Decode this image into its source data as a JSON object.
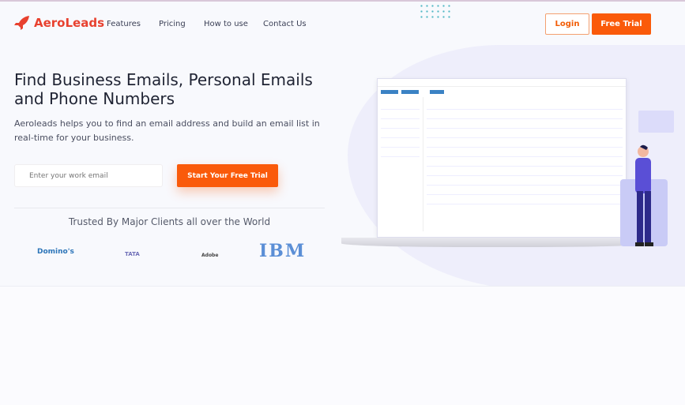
{
  "brand": {
    "name": "AeroLeads",
    "color": "#e8412f",
    "icon": "rocket-icon"
  },
  "nav": {
    "links": [
      "Features",
      "Pricing",
      "How to use",
      "Contact Us"
    ],
    "login": "Login",
    "free_trial": "Free Trial"
  },
  "hero": {
    "title": "Find Business Emails, Personal Emails and Phone Numbers",
    "subtitle": "Aeroleads helps you to find an email address and build an email list in real-time for your business.",
    "email_placeholder": "Enter your work email",
    "cta": "Start Your Free Trial",
    "accent": "#fa5a0a"
  },
  "trusted": {
    "heading": "Trusted By Major Clients all over the World",
    "clients": [
      "Domino's",
      "TATA",
      "Adobe",
      "IBM"
    ]
  }
}
